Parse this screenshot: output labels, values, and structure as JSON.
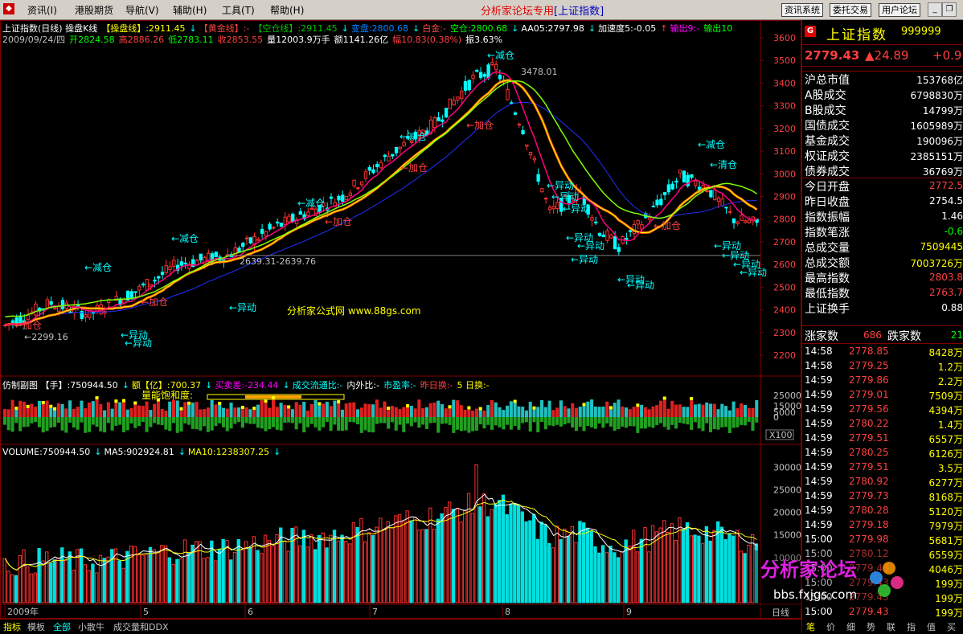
{
  "menu": {
    "items": [
      "资讯(I)",
      "港股期货",
      "导航(V)",
      "辅助(H)",
      "工具(T)",
      "帮助(H)"
    ],
    "title_prefix": "分析家论坛专用",
    "title_bracket": "[上证指数]",
    "buttons": [
      "资讯系统",
      "委托交易",
      "用户论坛"
    ]
  },
  "chart": {
    "header_line1": [
      {
        "text": "上证指数(日线) 操盘K线",
        "color": "#ffffff"
      },
      {
        "text": "【操盘线】:2911.45",
        "color": "#ffff00"
      },
      {
        "text": "↓",
        "color": "#00ffff"
      },
      {
        "text": "【黄金线】:-",
        "color": "#ff4040"
      },
      {
        "text": "【空仓线】:2911.45",
        "color": "#00c000"
      },
      {
        "text": "↓",
        "color": "#00ffff"
      },
      {
        "text": "变盘:2800.68",
        "color": "#0080ff"
      },
      {
        "text": "↓",
        "color": "#00ffff"
      },
      {
        "text": "白金:-",
        "color": "#ff4040"
      },
      {
        "text": "空仓:2800.68",
        "color": "#00ff00"
      },
      {
        "text": "↓",
        "color": "#00ffff"
      },
      {
        "text": "AA05:2797.98",
        "color": "#ffffff"
      },
      {
        "text": "↓",
        "color": "#00ffff"
      },
      {
        "text": "加速度5:-0.05",
        "color": "#ffffff"
      },
      {
        "text": "↑",
        "color": "#ff4040"
      },
      {
        "text": "输出9:-",
        "color": "#ff00ff"
      },
      {
        "text": "输出10",
        "color": "#00ff00"
      }
    ],
    "header_line2": [
      {
        "text": "2009/09/24/四",
        "color": "#c0c0c0"
      },
      {
        "text": "开2824.58",
        "color": "#00ff00"
      },
      {
        "text": "高2886.26",
        "color": "#ff4040"
      },
      {
        "text": "低2783.11",
        "color": "#00ff00"
      },
      {
        "text": "收2853.55",
        "color": "#ff4040"
      },
      {
        "text": "量12003.9万手",
        "color": "#ffffff"
      },
      {
        "text": "额1141.26亿",
        "color": "#ffffff"
      },
      {
        "text": "幅10.83(0.38%)",
        "color": "#ff4040"
      },
      {
        "text": "振3.63%",
        "color": "#ffffff"
      }
    ],
    "y_labels": [
      "3600",
      "3500",
      "3400",
      "3300",
      "3200",
      "3100",
      "3000",
      "2900",
      "2800",
      "2700",
      "2600",
      "2500",
      "2400",
      "2300",
      "2200"
    ],
    "annotations": [
      {
        "text": "←减仓",
        "color": "#00ffff"
      },
      {
        "text": "←减仓",
        "color": "#00ffff"
      },
      {
        "text": "←减仓",
        "color": "#00ffff"
      },
      {
        "text": "←减仓",
        "color": "#00ffff"
      },
      {
        "text": "←减仓",
        "color": "#00ffff"
      },
      {
        "text": "←减仓",
        "color": "#00ffff"
      },
      {
        "text": "←清仓",
        "color": "#00ffff"
      },
      {
        "text": "←加仓",
        "color": "#ff4040"
      },
      {
        "text": "←加仓",
        "color": "#ff4040"
      },
      {
        "text": "←加仓",
        "color": "#ff4040"
      },
      {
        "text": "←加仓",
        "color": "#ff4040"
      },
      {
        "text": "←加仓",
        "color": "#ff4040"
      },
      {
        "text": "←加仓",
        "color": "#ff4040"
      },
      {
        "text": "←异动",
        "color": "#00ffff"
      },
      {
        "text": "←异动",
        "color": "#00ffff"
      },
      {
        "text": "←异动",
        "color": "#00ffff"
      },
      {
        "text": "←异动",
        "color": "#00ffff"
      },
      {
        "text": "←异动",
        "color": "#00ffff"
      },
      {
        "text": "←异动",
        "color": "#00ffff"
      },
      {
        "text": "←异动",
        "color": "#00ffff"
      },
      {
        "text": "←异动",
        "color": "#00ffff"
      },
      {
        "text": "←异动",
        "color": "#00ffff"
      },
      {
        "text": "←异动",
        "color": "#00ffff"
      },
      {
        "text": "←异动",
        "color": "#00ffff"
      },
      {
        "text": "←异动",
        "color": "#00ffff"
      },
      {
        "text": "←异动",
        "color": "#00ffff"
      },
      {
        "text": "←异动",
        "color": "#00ffff"
      },
      {
        "text": "←异动",
        "color": "#00ffff"
      },
      {
        "text": "←异动",
        "color": "#00ffff"
      }
    ],
    "peak_label": "3478.01",
    "trough_label": "2299.16",
    "support_label": "2639.31-2639.76",
    "watermark": "分析家公式网  www.88gs.com",
    "sub1_header": [
      {
        "text": "仿制副图 【手】:750944.50",
        "color": "#ffffff"
      },
      {
        "text": "↓",
        "color": "#00ffff"
      },
      {
        "text": "额【亿】:700.37",
        "color": "#ffff00"
      },
      {
        "text": "↓",
        "color": "#00ffff"
      },
      {
        "text": "买卖差:-234.44",
        "color": "#ff00ff"
      },
      {
        "text": "↓",
        "color": "#00ffff"
      },
      {
        "text": "成交流通比:-",
        "color": "#00ffff"
      },
      {
        "text": "内外比:-",
        "color": "#ffffff"
      },
      {
        "text": "市盈率:-",
        "color": "#00ffff"
      },
      {
        "text": "昨日换:-",
        "color": "#ff4040"
      },
      {
        "text": "5 日换:-",
        "color": "#ffff00"
      }
    ],
    "sub1_label": "量能饱和度:",
    "sub1_y": [
      "25000",
      "15000",
      "5000",
      "0"
    ],
    "sub1_scale": "X100",
    "sub2_header": [
      {
        "text": "VOLUME:750944.50",
        "color": "#ffffff"
      },
      {
        "text": "↓",
        "color": "#00ffff"
      },
      {
        "text": "MA5:902924.81",
        "color": "#ffffff"
      },
      {
        "text": "↓",
        "color": "#00ffff"
      },
      {
        "text": "MA10:1238307.25",
        "color": "#ffff00"
      },
      {
        "text": "↓",
        "color": "#00ffff"
      }
    ],
    "sub2_y": [
      "30000",
      "25000",
      "20000",
      "15000",
      "10000"
    ],
    "period": "日线",
    "x_labels": [
      "2009年",
      "5",
      "6",
      "7",
      "8",
      "9"
    ]
  },
  "bottom_tabs": [
    "指标",
    "模板",
    "全部",
    "小散牛",
    "成交量和DDX"
  ],
  "panel": {
    "badge": "G",
    "name": "上证指数",
    "code": "999999",
    "price": "2779.43",
    "change": "▲24.89",
    "pct": "+0.9",
    "rows": [
      {
        "label": "沪总市值",
        "value": "153768亿",
        "color": "#ffffff"
      },
      {
        "label": "A股成交",
        "value": "6798830万",
        "color": "#ffffff"
      },
      {
        "label": "B股成交",
        "value": "14799万",
        "color": "#ffffff"
      },
      {
        "label": "国债成交",
        "value": "1605989万",
        "color": "#ffffff"
      },
      {
        "label": "基金成交",
        "value": "190096万",
        "color": "#ffffff"
      },
      {
        "label": "权证成交",
        "value": "2385151万",
        "color": "#ffffff"
      },
      {
        "label": "债券成交",
        "value": "36769万",
        "color": "#ffffff"
      },
      {
        "label": "今日开盘",
        "value": "2772.5",
        "color": "#ff4040"
      },
      {
        "label": "昨日收盘",
        "value": "2754.5",
        "color": "#ffffff"
      },
      {
        "label": "指数振幅",
        "value": "1.46",
        "color": "#ffffff"
      },
      {
        "label": "指数笔涨",
        "value": "-0.6",
        "color": "#00ff00"
      },
      {
        "label": "总成交量",
        "value": "7509445",
        "color": "#ffff00"
      },
      {
        "label": "总成交额",
        "value": "7003726万",
        "color": "#ffff00"
      },
      {
        "label": "最高指数",
        "value": "2803.8",
        "color": "#ff4040"
      },
      {
        "label": "最低指数",
        "value": "2763.7",
        "color": "#ff4040"
      },
      {
        "label": "上证换手",
        "value": "0.88",
        "color": "#ffffff"
      }
    ],
    "adv_label": "涨家数",
    "adv_value": "686",
    "dec_label": "跌家数",
    "dec_value": "21",
    "ticks": [
      {
        "t": "14:58",
        "p": "2778.85",
        "v": "8428万"
      },
      {
        "t": "14:58",
        "p": "2779.25",
        "v": "1.2万"
      },
      {
        "t": "14:59",
        "p": "2779.86",
        "v": "2.2万"
      },
      {
        "t": "14:59",
        "p": "2779.01",
        "v": "7509万"
      },
      {
        "t": "14:59",
        "p": "2779.56",
        "v": "4394万"
      },
      {
        "t": "14:59",
        "p": "2780.22",
        "v": "1.4万"
      },
      {
        "t": "14:59",
        "p": "2779.51",
        "v": "6557万"
      },
      {
        "t": "14:59",
        "p": "2780.25",
        "v": "6126万"
      },
      {
        "t": "14:59",
        "p": "2779.51",
        "v": "3.5万"
      },
      {
        "t": "14:59",
        "p": "2780.92",
        "v": "6277万"
      },
      {
        "t": "14:59",
        "p": "2779.73",
        "v": "8168万"
      },
      {
        "t": "14:59",
        "p": "2780.28",
        "v": "5120万"
      },
      {
        "t": "14:59",
        "p": "2779.18",
        "v": "7979万"
      },
      {
        "t": "15:00",
        "p": "2779.98",
        "v": "5681万"
      },
      {
        "t": "15:00",
        "p": "2780.12",
        "v": "6559万"
      },
      {
        "t": "15:00",
        "p": "2779.43",
        "v": "4046万"
      },
      {
        "t": "15:00",
        "p": "2779.43",
        "v": "199万"
      },
      {
        "t": "15:00",
        "p": "2779.43",
        "v": "199万"
      },
      {
        "t": "15:00",
        "p": "2779.43",
        "v": "199万"
      }
    ],
    "tabs": [
      "笔",
      "价",
      "细",
      "势",
      "联",
      "指",
      "值",
      "买"
    ],
    "logo_text": "分析家论坛",
    "logo_url": "bbs.fxjgs.com"
  }
}
